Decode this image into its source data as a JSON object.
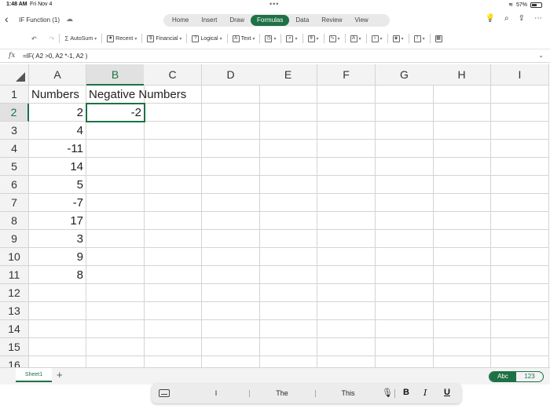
{
  "status": {
    "time": "1:48 AM",
    "date": "Fri Nov 4",
    "battery": "57%",
    "battery_level": 0.57
  },
  "title": {
    "doc": "IF Function (1)",
    "tabs": [
      "Home",
      "Insert",
      "Draw",
      "Formulas",
      "Data",
      "Review",
      "View"
    ],
    "active_tab": "Formulas"
  },
  "ribbon": {
    "autosum": "AutoSum",
    "recent": "Recent",
    "financial": "Financial",
    "logical": "Logical",
    "text": "Text"
  },
  "formula_bar": {
    "fx": "fx",
    "formula": "=IF( A2 >0, A2 *-1, A2 )"
  },
  "sheet": {
    "columns": [
      "A",
      "B",
      "C",
      "D",
      "E",
      "F",
      "G",
      "H",
      "I"
    ],
    "selected_column": "B",
    "rows": [
      "1",
      "2",
      "3",
      "4",
      "5",
      "6",
      "7",
      "8",
      "9",
      "10",
      "11",
      "12",
      "13",
      "14",
      "15",
      "16"
    ],
    "selected_row": "2",
    "cells": {
      "A1": "Numbers",
      "B1": "Negative Numbers",
      "A2": "2",
      "B2": "-2",
      "A3": "4",
      "A4": "-11",
      "A5": "14",
      "A6": "5",
      "A7": "-7",
      "A8": "17",
      "A9": "3",
      "A10": "9",
      "A11": "8"
    }
  },
  "sheet_tabs": {
    "current": "Sheet1",
    "add": "+"
  },
  "keyboard_toggle": {
    "abc": "Abc",
    "num": "123"
  },
  "suggestions": [
    "I",
    "The",
    "This"
  ],
  "format_buttons": {
    "bold": "B",
    "italic": "I",
    "underline": "U"
  },
  "accent_color": "#1e7145"
}
